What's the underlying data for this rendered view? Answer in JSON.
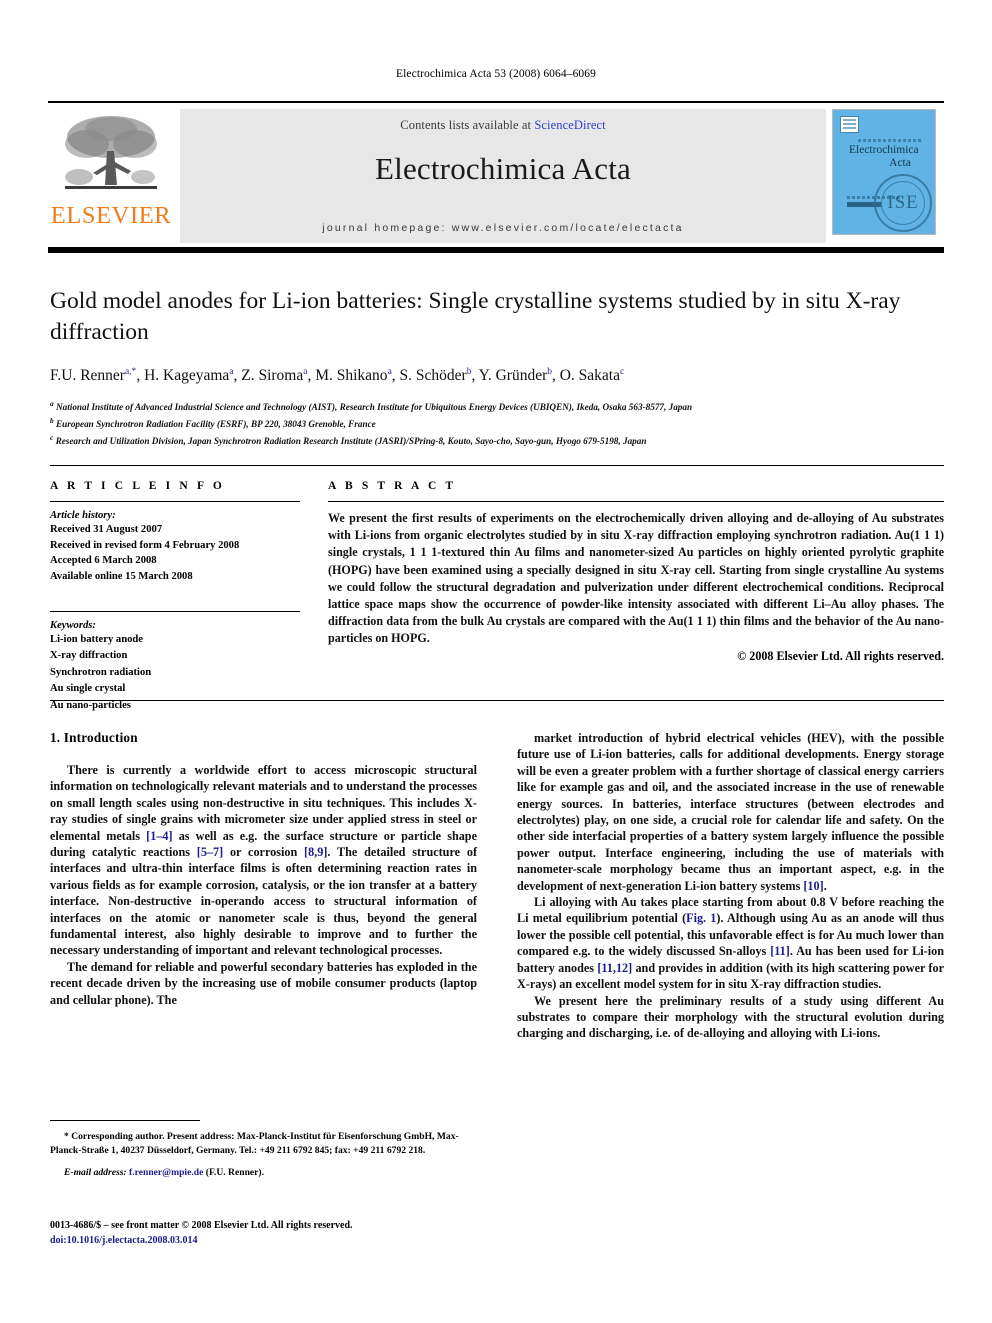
{
  "running_head": "Electrochimica Acta 53 (2008) 6064–6069",
  "masthead": {
    "contents_prefix": "Contents lists available at ",
    "sciencedirect": "ScienceDirect",
    "journal_name": "Electrochimica Acta",
    "homepage": "journal homepage: www.elsevier.com/locate/electacta",
    "publisher_wordmark": "ELSEVIER",
    "cover": {
      "title_line1": "Electrochimica",
      "title_line2": "Acta",
      "society_badge": "ISE"
    },
    "accent_orange": "#f07d1a",
    "link_blue": "#2b3fd0",
    "band_gray": "#e7e7e8"
  },
  "article": {
    "title": "Gold model anodes for Li-ion batteries: Single crystalline systems studied by in situ X-ray diffraction",
    "authors": [
      {
        "name": "F.U. Renner",
        "sup": "a,*"
      },
      {
        "name": "H. Kageyama",
        "sup": "a"
      },
      {
        "name": "Z. Siroma",
        "sup": "a"
      },
      {
        "name": "M. Shikano",
        "sup": "a"
      },
      {
        "name": "S. Schöder",
        "sup": "b"
      },
      {
        "name": "Y. Gründer",
        "sup": "b"
      },
      {
        "name": "O. Sakata",
        "sup": "c"
      }
    ],
    "affiliations": [
      {
        "sup": "a",
        "text": "National Institute of Advanced Industrial Science and Technology (AIST), Research Institute for Ubiquitous Energy Devices (UBIQEN), Ikeda, Osaka 563-8577, Japan"
      },
      {
        "sup": "b",
        "text": "European Synchrotron Radiation Facility (ESRF), BP 220, 38043 Grenoble, France"
      },
      {
        "sup": "c",
        "text": "Research and Utilization Division, Japan Synchrotron Radiation Research Institute (JASRI)/SPring-8, Kouto, Sayo-cho, Sayo-gun, Hyogo 679-5198, Japan"
      }
    ]
  },
  "article_info": {
    "heading": "A R T I C L E    I N F O",
    "history_label": "Article history:",
    "history": [
      "Received 31 August 2007",
      "Received in revised form 4 February 2008",
      "Accepted 6 March 2008",
      "Available online 15 March 2008"
    ],
    "keywords_label": "Keywords:",
    "keywords": [
      "Li-ion battery anode",
      "X-ray diffraction",
      "Synchrotron radiation",
      "Au single crystal",
      "Au nano-particles"
    ]
  },
  "abstract": {
    "heading": "A B S T R A C T",
    "text": "We present the first results of experiments on the electrochemically driven alloying and de-alloying of Au substrates with Li-ions from organic electrolytes studied by in situ X-ray diffraction employing synchrotron radiation. Au(1 1 1) single crystals, 1 1 1-textured thin Au films and nanometer-sized Au particles on highly oriented pyrolytic graphite (HOPG) have been examined using a specially designed in situ X-ray cell. Starting from single crystalline Au systems we could follow the structural degradation and pulverization under different electrochemical conditions. Reciprocal lattice space maps show the occurrence of powder-like intensity associated with different Li–Au alloy phases. The diffraction data from the bulk Au crystals are compared with the Au(1 1 1) thin films and the behavior of the Au nano-particles on HOPG.",
    "copyright": "© 2008 Elsevier Ltd. All rights reserved."
  },
  "body": {
    "section_number_title": "1. Introduction",
    "left_paragraphs": [
      "There is currently a worldwide effort to access microscopic structural information on technologically relevant materials and to understand the processes on small length scales using non-destructive in situ techniques. This includes X-ray studies of single grains with micrometer size under applied stress in steel or elemental metals [1–4] as well as e.g. the surface structure or particle shape during catalytic reactions [5–7] or corrosion [8,9]. The detailed structure of interfaces and ultra-thin interface films is often determining reaction rates in various fields as for example corrosion, catalysis, or the ion transfer at a battery interface. Non-destructive in-operando access to structural information of interfaces on the atomic or nanometer scale is thus, beyond the general fundamental interest, also highly desirable to improve and to further the necessary understanding of important and relevant technological processes.",
      "The demand for reliable and powerful secondary batteries has exploded in the recent decade driven by the increasing use of mobile consumer products (laptop and cellular phone). The"
    ],
    "right_paragraphs": [
      "market introduction of hybrid electrical vehicles (HEV), with the possible future use of Li-ion batteries, calls for additional developments. Energy storage will be even a greater problem with a further shortage of classical energy carriers like for example gas and oil, and the associated increase in the use of renewable energy sources. In batteries, interface structures (between electrodes and electrolytes) play, on one side, a crucial role for calendar life and safety. On the other side interfacial properties of a battery system largely influence the possible power output. Interface engineering, including the use of materials with nanometer-scale morphology became thus an important aspect, e.g. in the development of next-generation Li-ion battery systems [10].",
      "Li alloying with Au takes place starting from about 0.8 V before reaching the Li metal equilibrium potential (Fig. 1). Although using Au as an anode will thus lower the possible cell potential, this unfavorable effect is for Au much lower than compared e.g. to the widely discussed Sn-alloys [11]. Au has been used for Li-ion battery anodes [11,12] and provides in addition (with its high scattering power for X-rays) an excellent model system for in situ X-ray diffraction studies.",
      "We present here the preliminary results of a study using different Au substrates to compare their morphology with the structural evolution during charging and discharging, i.e. of de-alloying and alloying with Li-ions."
    ]
  },
  "footnotes": {
    "corresponding": "* Corresponding author. Present address: Max-Planck-Institut für Eisenforschung GmbH, Max-Planck-Straße 1, 40237 Düsseldorf, Germany. Tel.: +49 211 6792 845; fax: +49 211 6792 218.",
    "email_label": "E-mail address:",
    "email": "f.renner@mpie.de",
    "email_suffix": "(F.U. Renner).",
    "imprint_line": "0013-4686/$ – see front matter © 2008 Elsevier Ltd. All rights reserved.",
    "doi_line": "doi:10.1016/j.electacta.2008.03.014"
  }
}
